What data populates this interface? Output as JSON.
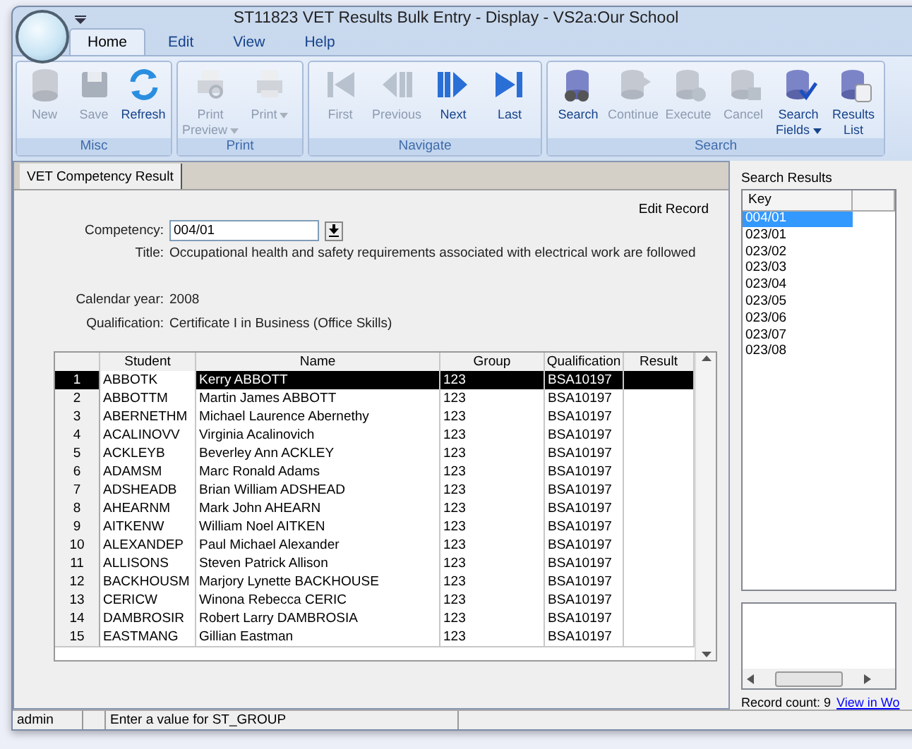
{
  "window": {
    "title": "ST11823 VET Results Bulk Entry - Display - VS2a:Our School"
  },
  "ribbon_tabs": [
    {
      "label": "Home",
      "selected": true
    },
    {
      "label": "Edit",
      "selected": false
    },
    {
      "label": "View",
      "selected": false
    },
    {
      "label": "Help",
      "selected": false
    }
  ],
  "ribbon_groups": [
    {
      "label": "Misc",
      "buttons": [
        {
          "label": "New",
          "disabled": true,
          "menu": false
        },
        {
          "label": "Save",
          "disabled": true,
          "menu": false
        },
        {
          "label": "Refresh",
          "disabled": false,
          "menu": false
        }
      ]
    },
    {
      "label": "Print",
      "buttons": [
        {
          "label": "Print Preview",
          "disabled": true,
          "menu": true
        },
        {
          "label": "Print",
          "disabled": true,
          "menu": true
        }
      ]
    },
    {
      "label": "Navigate",
      "buttons": [
        {
          "label": "First",
          "disabled": true,
          "menu": false
        },
        {
          "label": "Previous",
          "disabled": true,
          "menu": false
        },
        {
          "label": "Next",
          "disabled": false,
          "menu": false
        },
        {
          "label": "Last",
          "disabled": false,
          "menu": false
        }
      ]
    },
    {
      "label": "Search",
      "buttons": [
        {
          "label": "Search",
          "disabled": false,
          "menu": false
        },
        {
          "label": "Continue",
          "disabled": true,
          "menu": false
        },
        {
          "label": "Execute",
          "disabled": true,
          "menu": false
        },
        {
          "label": "Cancel",
          "disabled": true,
          "menu": false
        },
        {
          "label": "Search Fields",
          "disabled": false,
          "menu": true
        },
        {
          "label": "Results List",
          "disabled": false,
          "menu": false
        }
      ]
    }
  ],
  "doc_tab": {
    "label": "VET Competency Result",
    "selected": true
  },
  "edit_record": "Edit Record",
  "form": {
    "competency": {
      "label": "Competency:",
      "value": "004/01"
    },
    "title": {
      "label": "Title:",
      "value": "Occupational health and safety requirements associated with electrical work are followed"
    },
    "calendar_year": {
      "label": "Calendar year:",
      "value": "2008"
    },
    "qualification": {
      "label": "Qualification:",
      "value": "Certificate I in Business (Office Skills)"
    }
  },
  "grid": {
    "columns": [
      "Student",
      "Name",
      "Group",
      "Qualification",
      "Result"
    ],
    "rows": [
      {
        "number": "1",
        "student": "ABBOTK",
        "name": "Kerry ABBOTT",
        "group": "123",
        "qualification": "BSA10197",
        "selected": true
      },
      {
        "number": "2",
        "student": "ABBOTTM",
        "name": "Martin James ABBOTT",
        "group": "123",
        "qualification": "BSA10197",
        "selected": false
      },
      {
        "number": "3",
        "student": "ABERNETHM",
        "name": "Michael Laurence Abernethy",
        "group": "123",
        "qualification": "BSA10197",
        "selected": false
      },
      {
        "number": "4",
        "student": "ACALINOVV",
        "name": "Virginia Acalinovich",
        "group": "123",
        "qualification": "BSA10197",
        "selected": false
      },
      {
        "number": "5",
        "student": "ACKLEYB",
        "name": "Beverley Ann ACKLEY",
        "group": "123",
        "qualification": "BSA10197",
        "selected": false
      },
      {
        "number": "6",
        "student": "ADAMSM",
        "name": "Marc Ronald Adams",
        "group": "123",
        "qualification": "BSA10197",
        "selected": false
      },
      {
        "number": "7",
        "student": "ADSHEADB",
        "name": "Brian William ADSHEAD",
        "group": "123",
        "qualification": "BSA10197",
        "selected": false
      },
      {
        "number": "8",
        "student": "AHEARNM",
        "name": "Mark John AHEARN",
        "group": "123",
        "qualification": "BSA10197",
        "selected": false
      },
      {
        "number": "9",
        "student": "AITKENW",
        "name": "William Noel AITKEN",
        "group": "123",
        "qualification": "BSA10197",
        "selected": false
      },
      {
        "number": "10",
        "student": "ALEXANDEP",
        "name": "Paul Michael Alexander",
        "group": "123",
        "qualification": "BSA10197",
        "selected": false
      },
      {
        "number": "11",
        "student": "ALLISONS",
        "name": "Steven Patrick Allison",
        "group": "123",
        "qualification": "BSA10197",
        "selected": false
      },
      {
        "number": "12",
        "student": "BACKHOUSM",
        "name": "Marjory Lynette BACKHOUSE",
        "group": "123",
        "qualification": "BSA10197",
        "selected": false
      },
      {
        "number": "13",
        "student": "CERICW",
        "name": "Winona Rebecca CERIC",
        "group": "123",
        "qualification": "BSA10197",
        "selected": false
      },
      {
        "number": "14",
        "student": "DAMBROSIR",
        "name": "Robert Larry DAMBROSIA",
        "group": "123",
        "qualification": "BSA10197",
        "selected": false
      },
      {
        "number": "15",
        "student": "EASTMANG",
        "name": "Gillian Eastman",
        "group": "123",
        "qualification": "BSA10197",
        "selected": false
      }
    ]
  },
  "search_results": {
    "label": "Search Results",
    "column": "Key",
    "items": [
      {
        "key": "004/01",
        "selected": true
      },
      {
        "key": "023/01",
        "selected": false
      },
      {
        "key": "023/02",
        "selected": false
      },
      {
        "key": "023/03",
        "selected": false
      },
      {
        "key": "023/04",
        "selected": false
      },
      {
        "key": "023/05",
        "selected": false
      },
      {
        "key": "023/06",
        "selected": false
      },
      {
        "key": "023/07",
        "selected": false
      },
      {
        "key": "023/08",
        "selected": false
      }
    ],
    "record_count": "Record count: 9",
    "link": "View in Wo"
  },
  "status_bar": {
    "user": "admin",
    "message": "Enter a value for ST_GROUP"
  }
}
